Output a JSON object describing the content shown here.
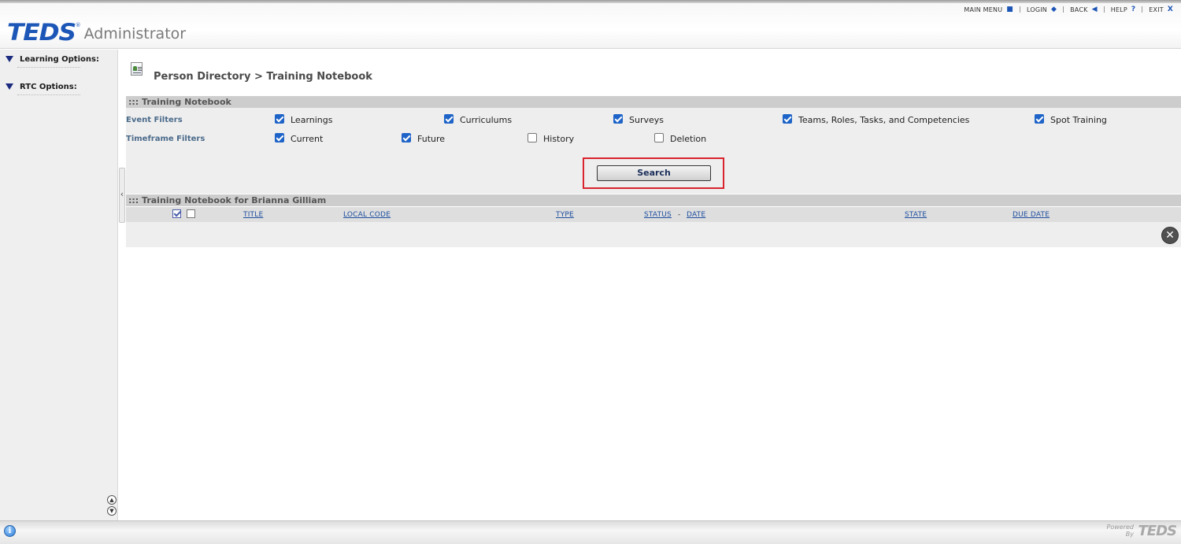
{
  "topnav": [
    {
      "label": "MAIN MENU",
      "icon": "■"
    },
    {
      "label": "LOGIN",
      "icon": "◆"
    },
    {
      "label": "BACK",
      "icon": "◀"
    },
    {
      "label": "HELP",
      "icon": "?"
    },
    {
      "label": "EXIT",
      "icon": "X"
    }
  ],
  "logo": {
    "mark": "TEDS",
    "reg": "®",
    "subtitle": "Administrator"
  },
  "sidebar": {
    "groups": [
      {
        "label": "Learning Options:"
      },
      {
        "label": "RTC Options:"
      }
    ]
  },
  "breadcrumb": "Person Directory > Training Notebook",
  "section1_title": "::: Training Notebook",
  "event_filters": {
    "label": "Event Filters",
    "options": [
      {
        "label": "Learnings",
        "checked": true
      },
      {
        "label": "Curriculums",
        "checked": true
      },
      {
        "label": "Surveys",
        "checked": true
      },
      {
        "label": "Teams, Roles, Tasks, and Competencies",
        "checked": true
      },
      {
        "label": "Spot Training",
        "checked": true
      }
    ]
  },
  "timeframe_filters": {
    "label": "Timeframe Filters",
    "options": [
      {
        "label": "Current",
        "checked": true
      },
      {
        "label": "Future",
        "checked": true
      },
      {
        "label": "History",
        "checked": false
      },
      {
        "label": "Deletion",
        "checked": false
      }
    ]
  },
  "search_label": "Search",
  "section2_title": "::: Training Notebook for Brianna Gilliam",
  "columns": {
    "title": "TITLE",
    "local_code": "LOCAL CODE",
    "type": "TYPE",
    "status": "STATUS",
    "status_sep": "-",
    "date": "DATE",
    "state": "STATE",
    "due_date": "DUE DATE"
  },
  "footer": {
    "powered_line1": "Powered",
    "powered_line2": "By",
    "powered_logo": "TEDS"
  },
  "colors": {
    "accent": "#1c57b7",
    "highlight": "#d9232d",
    "checkbox": "#1e64c8"
  }
}
